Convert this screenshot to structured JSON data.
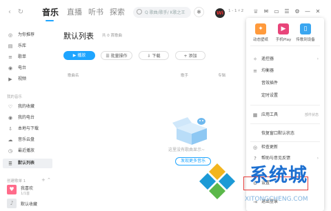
{
  "header": {
    "tabs": [
      {
        "label": "音乐",
        "active": true
      },
      {
        "label": "直播"
      },
      {
        "label": "听书"
      },
      {
        "label": "探索"
      }
    ],
    "search_placeholder": "Q 歌曲/歌手/ K歌之王",
    "user_avatar_text": "Wi",
    "user_level": "1 - 1 ♯ 2"
  },
  "sidebar": {
    "items": [
      {
        "label": "为你推荐",
        "icon": "◎"
      },
      {
        "label": "乐库",
        "icon": "▤"
      },
      {
        "label": "歌单",
        "icon": "≡"
      },
      {
        "label": "电台",
        "icon": "◉"
      },
      {
        "label": "视频",
        "icon": "▶"
      }
    ],
    "section_my": "我的音乐",
    "my_items": [
      {
        "label": "我的收藏",
        "icon": "♡"
      },
      {
        "label": "我的电台",
        "icon": "◉"
      },
      {
        "label": "本地与下载",
        "icon": "⇩"
      },
      {
        "label": "音乐云盘",
        "icon": "☁"
      },
      {
        "label": "最近播放",
        "icon": "◷"
      },
      {
        "label": "默认列表",
        "icon": "≣",
        "active": true
      }
    ],
    "section_created": "创建歌单 1",
    "created_items": [
      {
        "label": "我喜欢",
        "sub": "1/1首"
      },
      {
        "label": "默认收藏"
      }
    ]
  },
  "main": {
    "title": "默认列表",
    "count": "共 0 首歌曲",
    "buttons": {
      "play": "播放",
      "batch": "批量操作",
      "download": "下载",
      "add": "添加"
    },
    "columns": {
      "song": "歌曲名",
      "singer": "歌手",
      "album": "专辑"
    },
    "empty_text": "这里没有歌曲显示~",
    "find_button": "发现更多音乐"
  },
  "menu": {
    "top_items": [
      {
        "label": "动态壁纸",
        "color": "#ff9a3c",
        "icon": "✦"
      },
      {
        "label": "手机Play",
        "color": "#e8457a",
        "icon": "▶"
      },
      {
        "label": "传歌到设备",
        "color": "#3aa6f0",
        "icon": "▯"
      }
    ],
    "items": [
      {
        "label": "遥控器",
        "icon": "✧",
        "right": "›"
      },
      {
        "label": "均衡器",
        "icon": "≡",
        "right": ""
      },
      {
        "label": "音效插件",
        "icon": "",
        "right": ""
      },
      {
        "label": "定时设置",
        "icon": "",
        "right": ""
      },
      {
        "label": "应用工具",
        "icon": "▦",
        "right": "›"
      },
      {
        "label": "恢复窗口默认状态",
        "icon": "",
        "right": ""
      },
      {
        "label": "检查更新",
        "icon": "◎",
        "right": ""
      },
      {
        "label": "帮助与意见反馈",
        "icon": "?",
        "right": "›"
      },
      {
        "label": "设置",
        "icon": "⚙",
        "right": ""
      },
      {
        "label": "退出登录",
        "icon": "⇥",
        "right": ""
      }
    ],
    "app_tools_hint": "部件状态"
  },
  "watermark": {
    "text": "系统城",
    "url": "XITONGCHENG.COM"
  }
}
